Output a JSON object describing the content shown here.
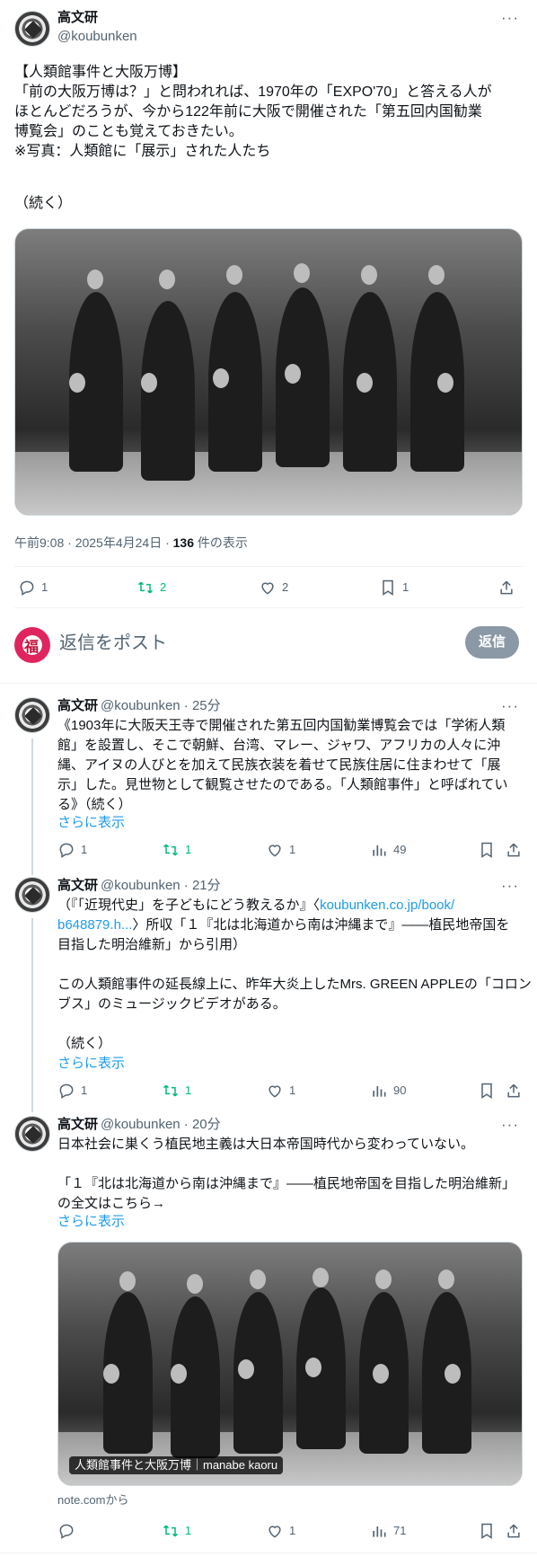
{
  "main": {
    "name": "高文研",
    "handle": "@koubunken",
    "text_line1": "【人類館事件と大阪万博】",
    "text_line2": "「前の大阪万博は？」と問われれば、1970年の「EXPO'70」と答える人が",
    "text_line3": "ほとんどだろうが、今から122年前に大阪で開催された「第五回内国勧業",
    "text_line4": "博覧会」のことも覚えておきたい。",
    "text_line5": "※写真：人類館に「展示」された人たち",
    "text_line6": "（続く）",
    "time": "午前9:08 · 2025年4月24日 · ",
    "views_count": "136",
    "views_label": " 件の表示",
    "stats": {
      "replies": "1",
      "retweets": "2",
      "likes": "2",
      "bookmarks": "1"
    }
  },
  "compose": {
    "avatar_glyph": "福",
    "placeholder": "返信をポスト",
    "button": "返信"
  },
  "replies": [
    {
      "name": "高文研",
      "handle": "@koubunken · 25分",
      "lines": [
        "《1903年に大阪天王寺で開催された第五回内国勧業博覧会では「学術人類",
        "館」を設置し、そこで朝鮮、台湾、マレー、ジャワ、アフリカの人々に沖",
        "縄、アイヌの人びとを加えて民族衣装を着せて民族住居に住まわせて「展",
        "示」した。見世物として観覧させたのである。「人類館事件」と呼ばれてい",
        "る》（続く）"
      ],
      "show_more": "さらに表示",
      "stats": {
        "replies": "1",
        "retweets": "1",
        "likes": "1",
        "views": "49"
      }
    },
    {
      "name": "高文研",
      "handle": "@koubunken · 21分",
      "line1_prefix": "（『「近現代史」を子どもにどう教えるか』〈",
      "line1_link": "koubunken.co.jp/book/",
      "line2_link": "b648879.h...",
      "line2_suffix": "〉所収「１『北は北海道から南は沖縄まで』――植民地帝国を",
      "line3": "目指した明治維新」から引用）",
      "line4": "この人類館事件の延長線上に、昨年大炎上したMrs. GREEN APPLEの「コロン",
      "line5": "ブス」のミュージックビデオがある。",
      "line6": "（続く）",
      "show_more": "さらに表示",
      "stats": {
        "replies": "1",
        "retweets": "1",
        "likes": "1",
        "views": "90"
      }
    },
    {
      "name": "高文研",
      "handle": "@koubunken · 20分",
      "line1": "日本社会に巣くう植民地主義は大日本帝国時代から変わっていない。",
      "line2": "「１『北は北海道から南は沖縄まで』――植民地帝国を目指した明治維新」",
      "line3": "の全文はこちら→",
      "show_more": "さらに表示",
      "card_caption": "人類館事件と大阪万博｜manabe kaoru",
      "source": "note.comから",
      "stats": {
        "retweets": "1",
        "likes": "1",
        "views": "71"
      }
    }
  ],
  "colors": {
    "link": "#1d9bf0",
    "retweet_green": "#00ba7c",
    "muted": "#536471"
  }
}
